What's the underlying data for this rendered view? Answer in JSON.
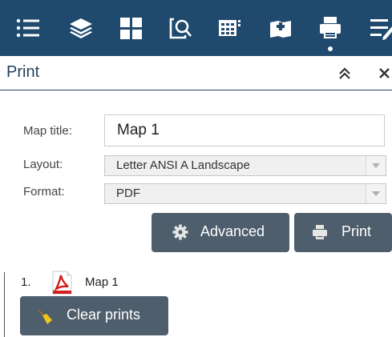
{
  "toolbar": {
    "icons": [
      "list-icon",
      "layers-icon",
      "basemap-gallery-icon",
      "query-icon",
      "legend-icon",
      "bookmark-icon",
      "print-icon",
      "attribute-table-icon"
    ],
    "active": "print-icon",
    "color": "#1f4a6e"
  },
  "panel": {
    "title": "Print"
  },
  "form": {
    "map_title_label": "Map title:",
    "map_title_value": "Map 1",
    "layout_label": "Layout:",
    "layout_value": "Letter ANSI A Landscape",
    "format_label": "Format:",
    "format_value": "PDF"
  },
  "buttons": {
    "advanced_label": "Advanced",
    "print_label": "Print",
    "clear_label": "Clear prints",
    "button_color": "#4f5e6c"
  },
  "results": [
    {
      "index": "1.",
      "name": "Map 1",
      "type": "pdf-icon"
    }
  ]
}
